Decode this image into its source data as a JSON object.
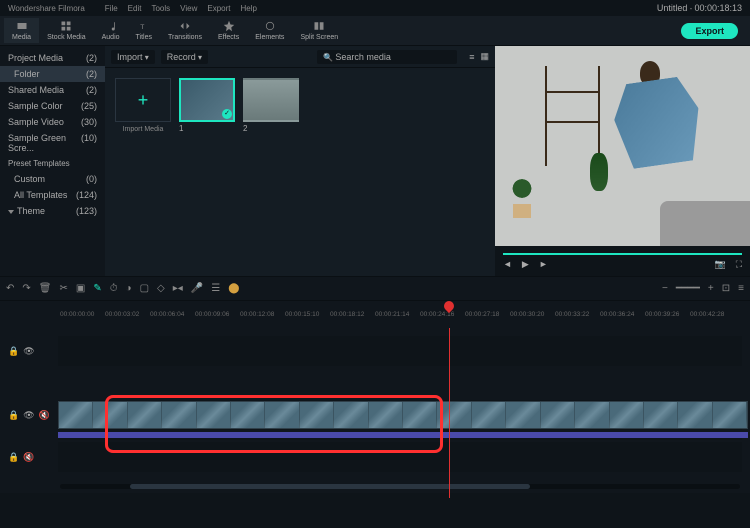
{
  "app": {
    "name": "Wondershare Filmora"
  },
  "menu": [
    "File",
    "Edit",
    "Tools",
    "View",
    "Export",
    "Help"
  ],
  "project": {
    "title": "Untitled",
    "timecode": "00:00:18:13"
  },
  "tabs": [
    {
      "id": "media",
      "label": "Media"
    },
    {
      "id": "stock",
      "label": "Stock Media"
    },
    {
      "id": "audio",
      "label": "Audio"
    },
    {
      "id": "titles",
      "label": "Titles"
    },
    {
      "id": "transitions",
      "label": "Transitions"
    },
    {
      "id": "effects",
      "label": "Effects"
    },
    {
      "id": "elements",
      "label": "Elements"
    },
    {
      "id": "split",
      "label": "Split Screen"
    }
  ],
  "export_label": "Export",
  "sidebar": {
    "items": [
      {
        "label": "Project Media",
        "count": "(2)"
      },
      {
        "label": "Folder",
        "count": "(2)",
        "active": true
      },
      {
        "label": "Shared Media",
        "count": "(2)"
      },
      {
        "label": "Sample Color",
        "count": "(25)"
      },
      {
        "label": "Sample Video",
        "count": "(30)"
      },
      {
        "label": "Sample Green Scre...",
        "count": "(10)"
      }
    ],
    "preset": "Preset Templates",
    "presets": [
      {
        "label": "Custom",
        "count": "(0)"
      },
      {
        "label": "All Templates",
        "count": "(124)"
      }
    ],
    "theme": {
      "label": "Theme",
      "count": "(123)"
    }
  },
  "media_tools": {
    "dd1": "Import",
    "dd2": "Record",
    "search_placeholder": "Search media"
  },
  "import_label": "Import Media",
  "clips": [
    {
      "label": "1",
      "selected": true
    },
    {
      "label": "2"
    }
  ],
  "annotation": "Delete",
  "ruler": [
    "00:00:00:00",
    "00:00:03:02",
    "00:00:06:04",
    "00:00:09:06",
    "00:00:12:08",
    "00:00:15:10",
    "00:00:18:12",
    "00:00:21:14",
    "00:00:24:16",
    "00:00:27:18",
    "00:00:30:20",
    "00:00:33:22",
    "00:00:36:24",
    "00:00:39:26",
    "00:00:42:28"
  ]
}
